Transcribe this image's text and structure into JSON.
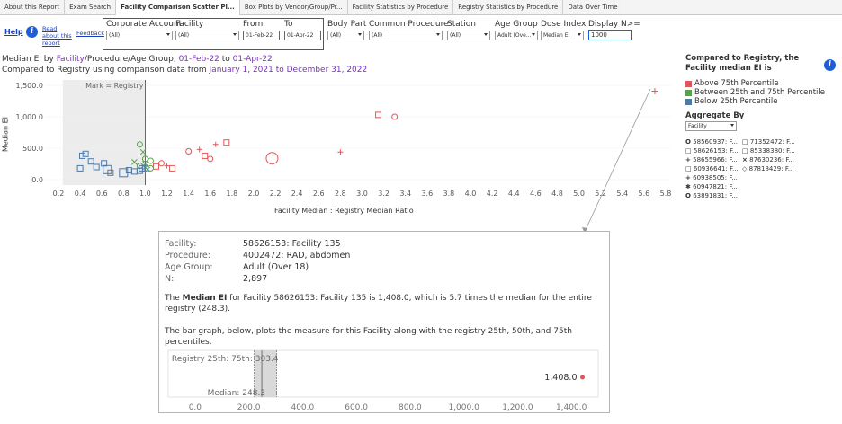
{
  "tabs": [
    "About this Report",
    "Exam Search",
    "Facility Comparison Scatter Pl...",
    "Box Plots by Vendor/Group/Pr...",
    "Facility Statistics by Procedure",
    "Registry Statistics by Procedure",
    "Data Over Time"
  ],
  "help": {
    "help_label": "Help",
    "read_about": "Read about this report",
    "feedback": "Feedback"
  },
  "filters": {
    "corporate_account": {
      "label": "Corporate Account",
      "value": "(All)"
    },
    "facility": {
      "label": "Facility",
      "value": "(All)"
    },
    "from": {
      "label": "From",
      "value": "01-Feb-22"
    },
    "to": {
      "label": "To",
      "value": "01-Apr-22"
    },
    "body_part": {
      "label": "Body Part",
      "value": "(All)"
    },
    "common_procedure": {
      "label": "Common Procedure",
      "value": "(All)"
    },
    "station": {
      "label": "Station",
      "value": "(All)"
    },
    "age_group": {
      "label": "Age Group",
      "value": "Adult (Ove..."
    },
    "dose_index": {
      "label": "Dose Index",
      "value": "Median EI"
    },
    "display_n": {
      "label": "Display N>=",
      "value": "1000"
    }
  },
  "title": {
    "line1_a": "Median EI by ",
    "line1_facility": "Facility",
    "line1_b": "/Procedure/Age Group, ",
    "line1_from": "01-Feb-22",
    "line1_to_word": " to ",
    "line1_to": "01-Apr-22",
    "line2_a": "Compared to Registry using comparison data from ",
    "line2_range": "January 1, 2021 to December 31, 2022"
  },
  "chart": {
    "ylabel": "Median EI",
    "xlabel": "Facility Median : Registry Median Ratio",
    "mark_label": "Mark = Registry"
  },
  "chart_data": {
    "type": "scatter",
    "xlabel": "Facility Median : Registry Median Ratio",
    "ylabel": "Median EI",
    "xlim": [
      0.2,
      5.8
    ],
    "ylim": [
      0,
      1500
    ],
    "x_ticks": [
      "0.2",
      "0.4",
      "0.6",
      "0.8",
      "1.0",
      "1.2",
      "1.4",
      "1.6",
      "1.8",
      "2.0",
      "2.2",
      "2.4",
      "2.6",
      "2.8",
      "3.0",
      "3.2",
      "3.4",
      "3.6",
      "3.8",
      "4.0",
      "4.2",
      "4.4",
      "4.6",
      "4.8",
      "5.0",
      "5.2",
      "5.4",
      "5.6",
      "5.8"
    ],
    "y_ticks": [
      "1,500.0",
      "1,000.0",
      "500.0",
      "0.0"
    ],
    "reference_x": 1.0,
    "series": [
      {
        "name": "Above 75th Percentile",
        "color": "#e15759",
        "points": [
          [
            1.1,
            210
          ],
          [
            1.15,
            260
          ],
          [
            1.2,
            220
          ],
          [
            1.25,
            180
          ],
          [
            1.4,
            450
          ],
          [
            1.5,
            480
          ],
          [
            1.55,
            380
          ],
          [
            1.6,
            330
          ],
          [
            1.65,
            560
          ],
          [
            1.75,
            590
          ],
          [
            2.17,
            340
          ],
          [
            2.8,
            440
          ],
          [
            3.15,
            1030
          ],
          [
            3.3,
            1000
          ],
          [
            5.7,
            1408
          ]
        ]
      },
      {
        "name": "Between 25th and 75th Percentile",
        "color": "#59a14f",
        "points": [
          [
            0.95,
            560
          ],
          [
            0.98,
            440
          ],
          [
            1.0,
            330
          ],
          [
            0.9,
            280
          ],
          [
            1.05,
            300
          ],
          [
            1.0,
            250
          ],
          [
            0.95,
            220
          ],
          [
            1.0,
            200
          ],
          [
            1.05,
            180
          ],
          [
            1.02,
            160
          ]
        ]
      },
      {
        "name": "Below 25th Percentile",
        "color": "#4e79a7",
        "points": [
          [
            0.42,
            380
          ],
          [
            0.45,
            410
          ],
          [
            0.4,
            180
          ],
          [
            0.55,
            200
          ],
          [
            0.5,
            290
          ],
          [
            0.62,
            260
          ],
          [
            0.65,
            160
          ],
          [
            0.68,
            110
          ],
          [
            0.8,
            110
          ],
          [
            0.85,
            150
          ],
          [
            0.9,
            130
          ],
          [
            0.95,
            140
          ],
          [
            0.97,
            180
          ],
          [
            1.0,
            170
          ]
        ]
      }
    ]
  },
  "right_legend": {
    "title": "Compared to Registry, the Facility median EI is",
    "items": [
      {
        "label": "Above 75th Percentile",
        "color": "#e15759"
      },
      {
        "label": "Between 25th and 75th Percentile",
        "color": "#59a14f"
      },
      {
        "label": "Below 25th Percentile",
        "color": "#4e79a7"
      }
    ],
    "aggregate_label": "Aggregate By",
    "aggregate_value": "Facility",
    "shape_col1": [
      {
        "sym": "O",
        "text": "58560937: F..."
      },
      {
        "sym": "□",
        "text": "58626153: F..."
      },
      {
        "sym": "+",
        "text": "58655966: F..."
      },
      {
        "sym": "□",
        "text": "60936641: F..."
      },
      {
        "sym": "+",
        "text": "60938505: F..."
      },
      {
        "sym": "✱",
        "text": "60947821: F..."
      },
      {
        "sym": "O",
        "text": "63891831: F..."
      }
    ],
    "shape_col2": [
      {
        "sym": "□",
        "text": "71352472: F..."
      },
      {
        "sym": "□",
        "text": "85338380: F..."
      },
      {
        "sym": "×",
        "text": "87630236: F..."
      },
      {
        "sym": "◇",
        "text": "87818429: F..."
      }
    ]
  },
  "tooltip": {
    "facility_label": "Facility:",
    "facility_value": "58626153: Facility 135",
    "procedure_label": "Procedure:",
    "procedure_value": "4002472: RAD, abdomen",
    "age_label": "Age Group:",
    "age_value": "Adult (Over 18)",
    "n_label": "N:",
    "n_value": "2,897",
    "para1_a": "The ",
    "para1_bold": "Median EI",
    "para1_b": " for Facility 58626153: Facility 135 is 1,408.0, which is 5.7 times the median for the entire registry (248.3).",
    "para2": "The bar graph, below, plots the measure for this Facility along with the registry 25th, 50th, and 75th percentiles.",
    "bar_upper_label": "Registry 25th: 75th: 303.4",
    "bar_median_label": "Median: 248.3",
    "bar_value_label": "1,408.0",
    "bar_ticks": [
      "0.0",
      "200.0",
      "400.0",
      "600.0",
      "800.0",
      "1,000.0",
      "1,200.0",
      "1,400.0"
    ],
    "bar_data": {
      "registry_25th": 220,
      "registry_median": 248.3,
      "registry_75th": 303.4,
      "facility_value": 1408.0,
      "xlim": [
        -100,
        1500
      ]
    }
  },
  "colors": {
    "link": "#1a3fbf",
    "purple_date": "#7b2fbe",
    "above": "#e15759",
    "between": "#59a14f",
    "below": "#4e79a7",
    "info": "#1f5ed4"
  }
}
